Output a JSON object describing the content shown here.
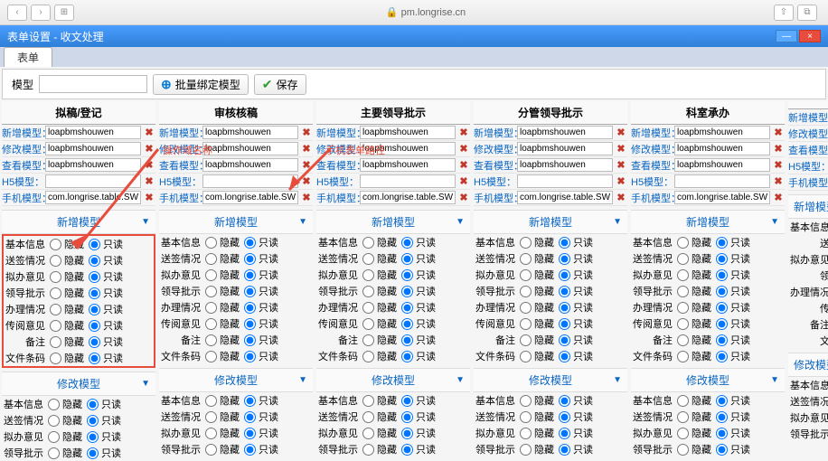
{
  "browser": {
    "url": "pm.longrise.cn",
    "back": "‹",
    "fwd": "›",
    "grid": "⊞",
    "share": "⇧",
    "tabs": "⧉"
  },
  "window": {
    "title": "表单设置 - 收文处理",
    "min": "—",
    "close": "×"
  },
  "tab": {
    "label": "表单"
  },
  "toolbar": {
    "modelLabel": "模型",
    "bindBtn": "批量绑定模型",
    "saveBtn": "保存"
  },
  "columnHeaders": [
    "拟稿/登记",
    "审核核稿",
    "主要领导批示",
    "分管领导批示",
    "科室承办",
    ""
  ],
  "formRows": [
    {
      "label": "新增模型：",
      "value": "loapbmshouwen"
    },
    {
      "label": "修改模型：",
      "value": "loapbmshouwen"
    },
    {
      "label": "查看模型：",
      "value": "loapbmshouwen"
    },
    {
      "label": "H5模型：",
      "value": ""
    },
    {
      "label": "手机模型：",
      "value": "com.longrise.table.SW_ZNJ_Ti"
    }
  ],
  "sectionNew": "新增模型",
  "sectionEdit": "修改模型",
  "radioOpts": {
    "hide": "隐藏",
    "readonly": "只读"
  },
  "fieldsNew": [
    "基本信息",
    "送签情况",
    "拟办意见",
    "领导批示",
    "办理情况",
    "传阅意见",
    "备注",
    "文件条码"
  ],
  "fieldsEdit": [
    "基本信息",
    "送签情况",
    "拟办意见",
    "领导批示"
  ],
  "annot1": "操作域名称",
  "annot2": "手机表单路径"
}
